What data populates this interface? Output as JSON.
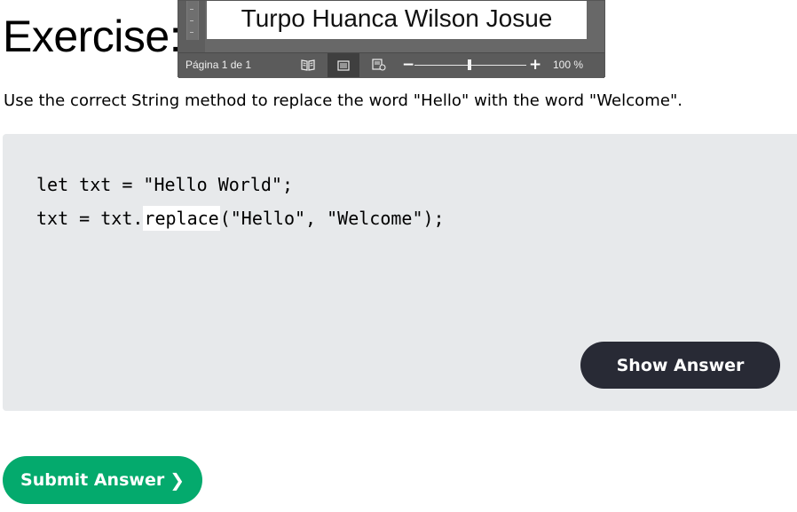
{
  "page": {
    "title": "Exercise:",
    "instructions": "Use the correct String method to replace the word \"Hello\" with the word \"Welcome\"."
  },
  "word_window": {
    "document_text": "Turpo Huanca Wilson Josue",
    "status": {
      "page_indicator": "Página 1 de 1",
      "zoom_value": "100 %",
      "zoom_level_percent": 100
    },
    "icons": [
      "read-mode-icon",
      "print-layout-icon",
      "web-layout-icon",
      "zoom-out-icon",
      "zoom-in-icon"
    ]
  },
  "code": {
    "line1": "let txt = \"Hello World\";",
    "line2_prefix": "txt = txt.",
    "line2_input_value": "replace",
    "line2_suffix": "(\"Hello\", \"Welcome\");"
  },
  "buttons": {
    "show_answer": "Show Answer",
    "submit": "Submit Answer",
    "submit_icon": "chevron-right-icon",
    "submit_icon_glyph": "❯"
  },
  "colors": {
    "code_panel_bg": "#e7e9eb",
    "show_answer_bg": "#282a35",
    "submit_bg": "#04aa6d"
  }
}
